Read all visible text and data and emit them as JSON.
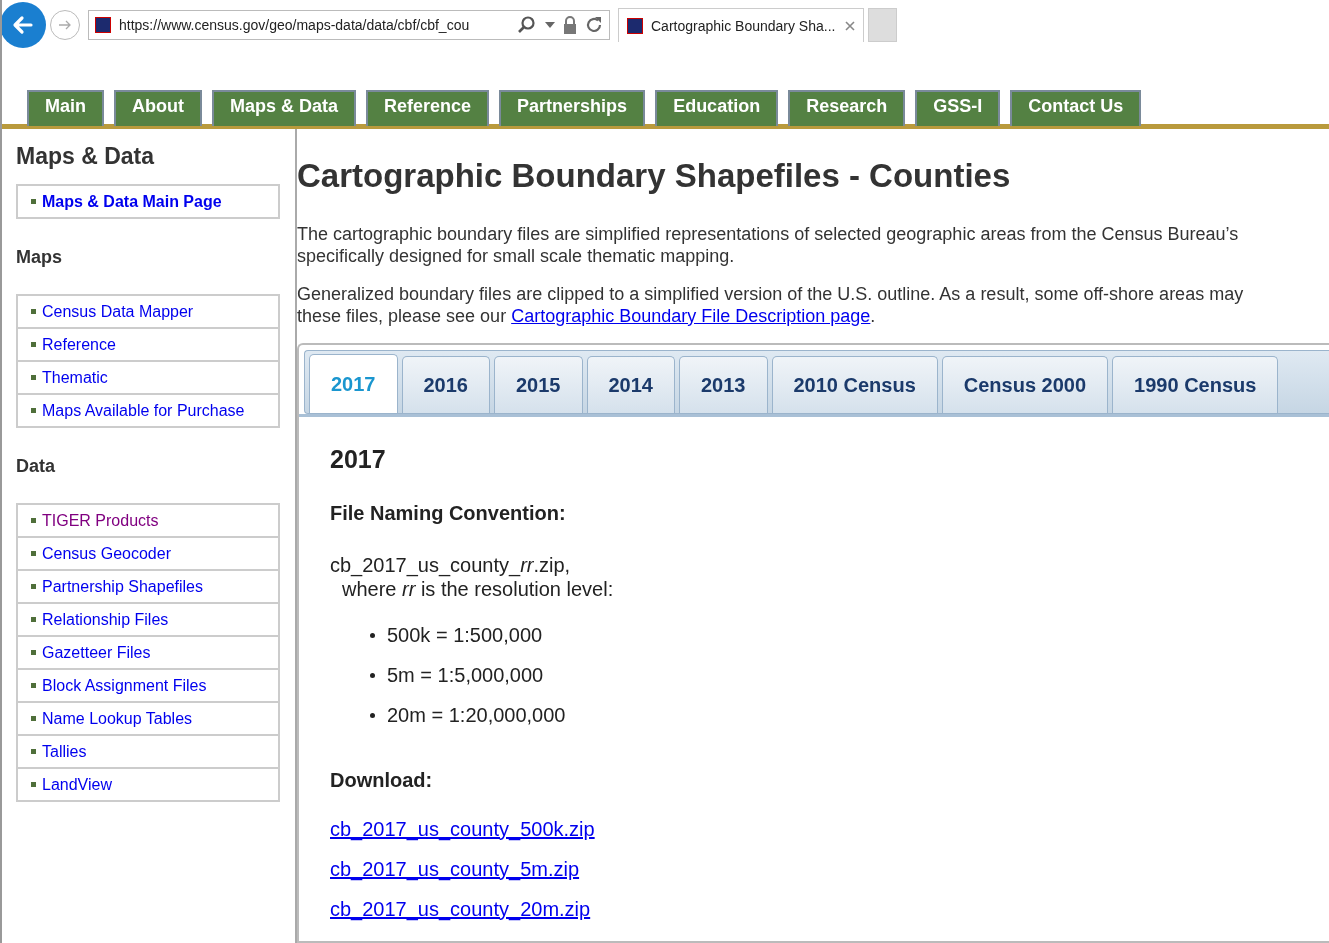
{
  "browser": {
    "address": "https://www.census.gov/geo/maps-data/data/cbf/cbf_cou",
    "tab_title": "Cartographic Boundary Sha..."
  },
  "nav": [
    {
      "label": "Main"
    },
    {
      "label": "About"
    },
    {
      "label": "Maps & Data"
    },
    {
      "label": "Reference"
    },
    {
      "label": "Partnerships"
    },
    {
      "label": "Education"
    },
    {
      "label": "Research"
    },
    {
      "label": "GSS-I"
    },
    {
      "label": "Contact Us"
    }
  ],
  "sidebar": {
    "title": "Maps & Data",
    "sections": [
      {
        "items": [
          {
            "label": "Maps & Data Main Page",
            "bold": true,
            "visited": false
          }
        ]
      },
      {
        "heading": "Maps",
        "items": [
          {
            "label": "Census Data Mapper",
            "bold": false,
            "visited": false
          },
          {
            "label": "Reference",
            "bold": false,
            "visited": false
          },
          {
            "label": "Thematic",
            "bold": false,
            "visited": false
          },
          {
            "label": "Maps Available for Purchase",
            "bold": false,
            "visited": false
          }
        ]
      },
      {
        "heading": "Data",
        "items": [
          {
            "label": "TIGER Products",
            "bold": false,
            "visited": true
          },
          {
            "label": "Census Geocoder",
            "bold": false,
            "visited": false
          },
          {
            "label": "Partnership Shapefiles",
            "bold": false,
            "visited": false
          },
          {
            "label": "Relationship Files",
            "bold": false,
            "visited": false
          },
          {
            "label": "Gazetteer Files",
            "bold": false,
            "visited": false
          },
          {
            "label": "Block Assignment Files",
            "bold": false,
            "visited": false
          },
          {
            "label": "Name Lookup Tables",
            "bold": false,
            "visited": false
          },
          {
            "label": "Tallies",
            "bold": false,
            "visited": false
          },
          {
            "label": "LandView",
            "bold": false,
            "visited": false
          }
        ]
      }
    ]
  },
  "page_title": "Cartographic Boundary Shapefiles - Counties",
  "intro": [
    {
      "lines": [
        "The cartographic boundary files are simplified representations of selected geographic areas from the Census Bureau’s",
        "specifically designed for small scale thematic mapping."
      ]
    },
    {
      "lines": [
        "Generalized boundary files are clipped to a simplified version of the U.S. outline. As a result, some off-shore areas may",
        "these files, please see our"
      ],
      "link": "Cartographic Boundary File Description page",
      "after": "."
    }
  ],
  "year_tabs": [
    {
      "label": "2017",
      "selected": true
    },
    {
      "label": "2016",
      "selected": false
    },
    {
      "label": "2015",
      "selected": false
    },
    {
      "label": "2014",
      "selected": false
    },
    {
      "label": "2013",
      "selected": false
    },
    {
      "label": "2010 Census",
      "selected": false
    },
    {
      "label": "Census 2000",
      "selected": false
    },
    {
      "label": "1990 Census",
      "selected": false
    }
  ],
  "panel": {
    "heading": "2017",
    "naming_heading": "File Naming Convention:",
    "pattern": {
      "before": "cb_2017_us_county_",
      "variable": "rr",
      "after": ".zip,"
    },
    "pattern_note": "where *rr* is the resolution level:",
    "levels": [
      "500k = 1:500,000",
      "5m = 1:5,000,000",
      "20m = 1:20,000,000"
    ],
    "download_heading": "Download:",
    "downloads": [
      "cb_2017_us_county_500k.zip",
      "cb_2017_us_county_5m.zip",
      "cb_2017_us_county_20m.zip"
    ]
  }
}
